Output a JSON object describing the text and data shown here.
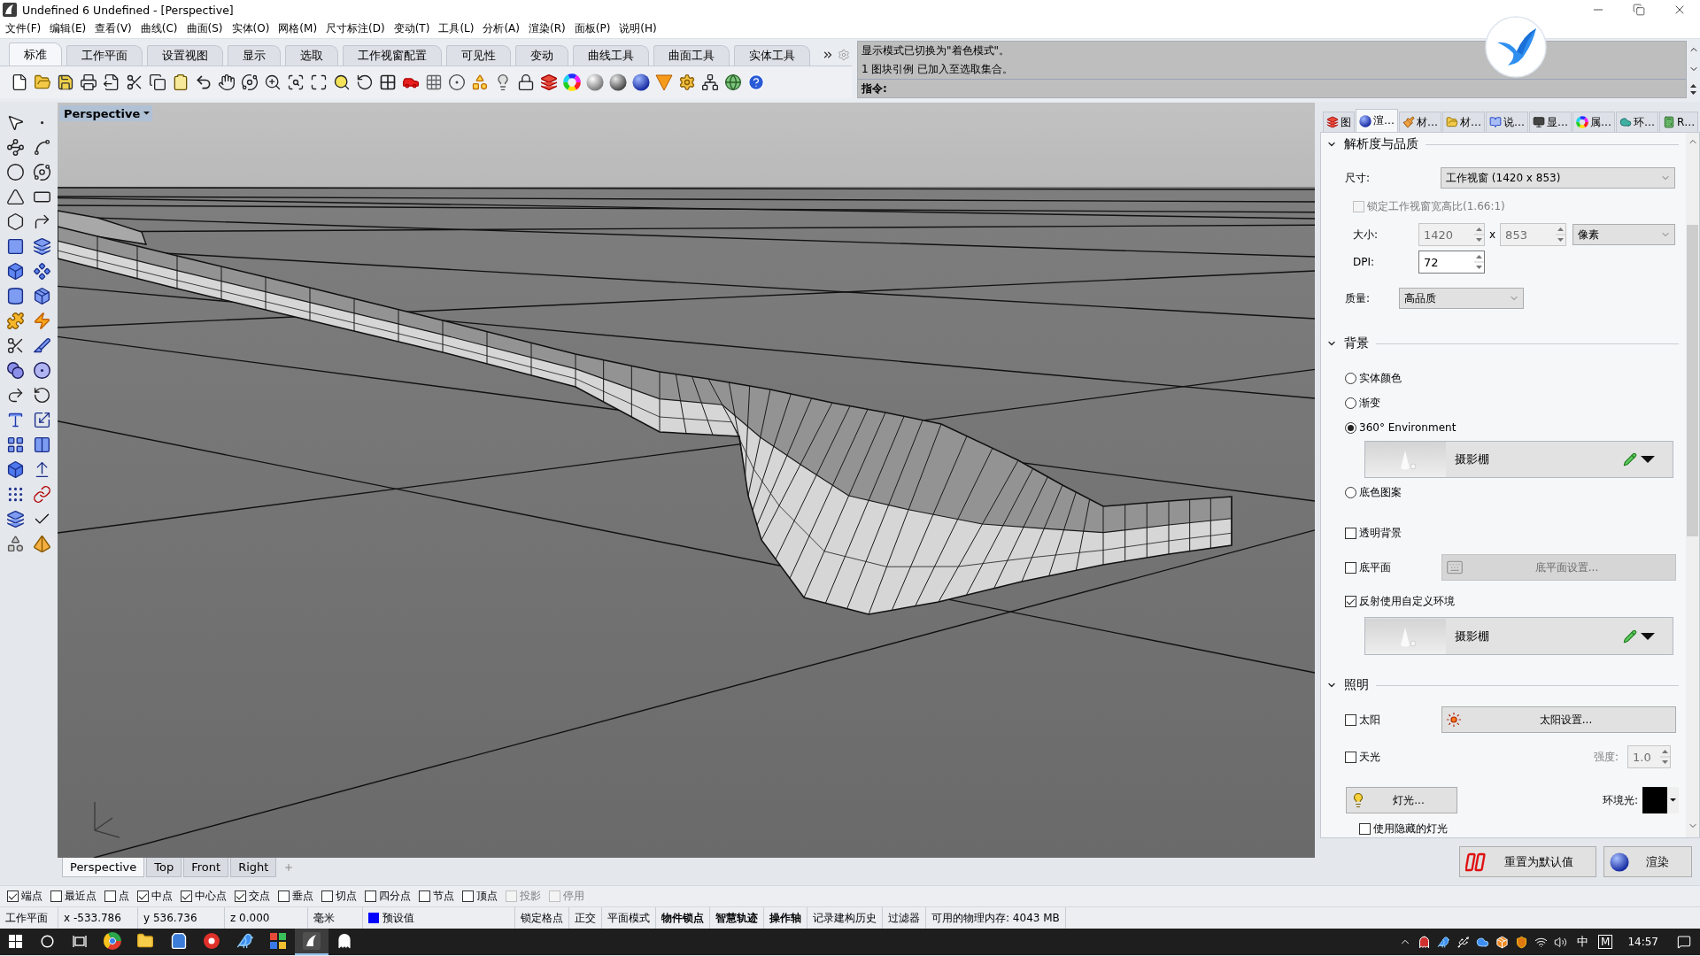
{
  "window": {
    "title": "Undefined 6 Undefined - [Perspective]"
  },
  "menu": [
    "文件(F)",
    "编辑(E)",
    "查看(V)",
    "曲线(C)",
    "曲面(S)",
    "实体(O)",
    "网格(M)",
    "尺寸标注(D)",
    "变动(T)",
    "工具(L)",
    "分析(A)",
    "渲染(R)",
    "面板(P)",
    "说明(H)"
  ],
  "toolbar_tabs": [
    {
      "label": "标准",
      "selected": true
    },
    {
      "label": "工作平面",
      "selected": false
    },
    {
      "label": "设置视图",
      "selected": false
    },
    {
      "label": "显示",
      "selected": false
    },
    {
      "label": "选取",
      "selected": false
    },
    {
      "label": "工作视窗配置",
      "selected": false
    },
    {
      "label": "可见性",
      "selected": false
    },
    {
      "label": "变动",
      "selected": false
    },
    {
      "label": "曲线工具",
      "selected": false
    },
    {
      "label": "曲面工具",
      "selected": false
    },
    {
      "label": "实体工具",
      "selected": false
    }
  ],
  "command": {
    "history": [
      "显示模式已切换为\"着色模式\"。",
      "1 图块引例 已加入至选取集合。"
    ],
    "prompt": "指令:"
  },
  "viewport": {
    "title": "Perspective"
  },
  "viewport_tabs": [
    {
      "label": "Perspective",
      "selected": true
    },
    {
      "label": "Top",
      "selected": false
    },
    {
      "label": "Front",
      "selected": false
    },
    {
      "label": "Right",
      "selected": false
    }
  ],
  "render_panel": {
    "tabs": [
      {
        "label": "图",
        "selected": false
      },
      {
        "label": "渲…",
        "selected": true
      },
      {
        "label": "材…",
        "selected": false
      },
      {
        "label": "材…",
        "selected": false
      },
      {
        "label": "说…",
        "selected": false
      },
      {
        "label": "显…",
        "selected": false
      },
      {
        "label": "属…",
        "selected": false
      },
      {
        "label": "环…",
        "selected": false
      },
      {
        "label": "R…",
        "selected": false
      }
    ],
    "resolution": {
      "title": "解析度与品质",
      "expanded": true,
      "size_label": "尺寸:",
      "size": "工作视窗 (1420 x 853)",
      "lock_aspect": {
        "label": "锁定工作视窗宽高比(1.66:1)",
        "checked": false,
        "disabled": true
      },
      "dimensions_label": "大小:",
      "width": {
        "value": "1420",
        "disabled": true
      },
      "by": "x",
      "height": {
        "value": "853",
        "disabled": true
      },
      "unit": "像素",
      "dpi_label": "DPI:",
      "dpi": {
        "value": "72",
        "disabled": false
      },
      "quality_label": "质量:",
      "quality": "高品质"
    },
    "background": {
      "title": "背景",
      "expanded": true,
      "options": [
        {
          "label": "实体颜色",
          "selected": false
        },
        {
          "label": "渐变",
          "selected": false
        },
        {
          "label": "360° Environment",
          "selected": true,
          "environment": "摄影棚"
        },
        {
          "label": "底色图案",
          "selected": false
        }
      ],
      "transparent": {
        "label": "透明背景",
        "checked": false
      },
      "ground_plane": {
        "label": "底平面",
        "checked": false,
        "button": "底平面设置...",
        "button_disabled": true
      },
      "reflection": {
        "label": "反射使用自定义环境",
        "checked": true,
        "environment": "摄影棚"
      }
    },
    "lighting": {
      "title": "照明",
      "expanded": true,
      "sun": {
        "label": "太阳",
        "checked": false,
        "button": "太阳设置..."
      },
      "skylight": {
        "label": "天光",
        "checked": false,
        "intensity_label": "强度:",
        "intensity": "1.0",
        "intensity_disabled": true
      },
      "lights_button": "灯光...",
      "ambient_label": "环境光:",
      "hidden_lights": {
        "label": "使用隐藏的灯光",
        "checked": false
      }
    },
    "reset_button": "重置为默认值",
    "render_button": "渲染"
  },
  "osnaps": [
    {
      "label": "端点",
      "checked": true,
      "disabled": false
    },
    {
      "label": "最近点",
      "checked": false,
      "disabled": false
    },
    {
      "label": "点",
      "checked": false,
      "disabled": false
    },
    {
      "label": "中点",
      "checked": true,
      "disabled": false
    },
    {
      "label": "中心点",
      "checked": true,
      "disabled": false
    },
    {
      "label": "交点",
      "checked": true,
      "disabled": false
    },
    {
      "label": "垂点",
      "checked": false,
      "disabled": false
    },
    {
      "label": "切点",
      "checked": false,
      "disabled": false
    },
    {
      "label": "四分点",
      "checked": false,
      "disabled": false
    },
    {
      "label": "节点",
      "checked": false,
      "disabled": false
    },
    {
      "label": "顶点",
      "checked": false,
      "disabled": false
    },
    {
      "label": "投影",
      "checked": false,
      "disabled": true
    },
    {
      "label": "停用",
      "checked": false,
      "disabled": true
    }
  ],
  "status_bar": {
    "cplane": "工作平面",
    "x": "x -533.786",
    "y": "y 536.736",
    "z": "z 0.000",
    "units": "毫米",
    "layer": {
      "name": "预设值",
      "color": "#0000ff"
    },
    "toggles": [
      {
        "label": "锁定格点",
        "on": false
      },
      {
        "label": "正交",
        "on": false
      },
      {
        "label": "平面模式",
        "on": false
      },
      {
        "label": "物件锁点",
        "on": true
      },
      {
        "label": "智慧轨迹",
        "on": true
      },
      {
        "label": "操作轴",
        "on": true
      },
      {
        "label": "记录建构历史",
        "on": false
      },
      {
        "label": "过滤器",
        "on": false
      }
    ],
    "memory": "可用的物理内存: 4043 MB"
  },
  "taskbar": {
    "apps": [
      {
        "kind": "ring",
        "selected": false
      },
      {
        "kind": "folder",
        "selected": false
      },
      {
        "kind": "bag",
        "selected": false
      },
      {
        "kind": "disc",
        "selected": false
      },
      {
        "kind": "bird",
        "selected": false
      },
      {
        "kind": "tiles",
        "selected": false
      },
      {
        "kind": "horn",
        "selected": true
      },
      {
        "kind": "ghost",
        "selected": false
      }
    ],
    "ime": "中",
    "ime_mode": "M",
    "clock": "14:57"
  }
}
